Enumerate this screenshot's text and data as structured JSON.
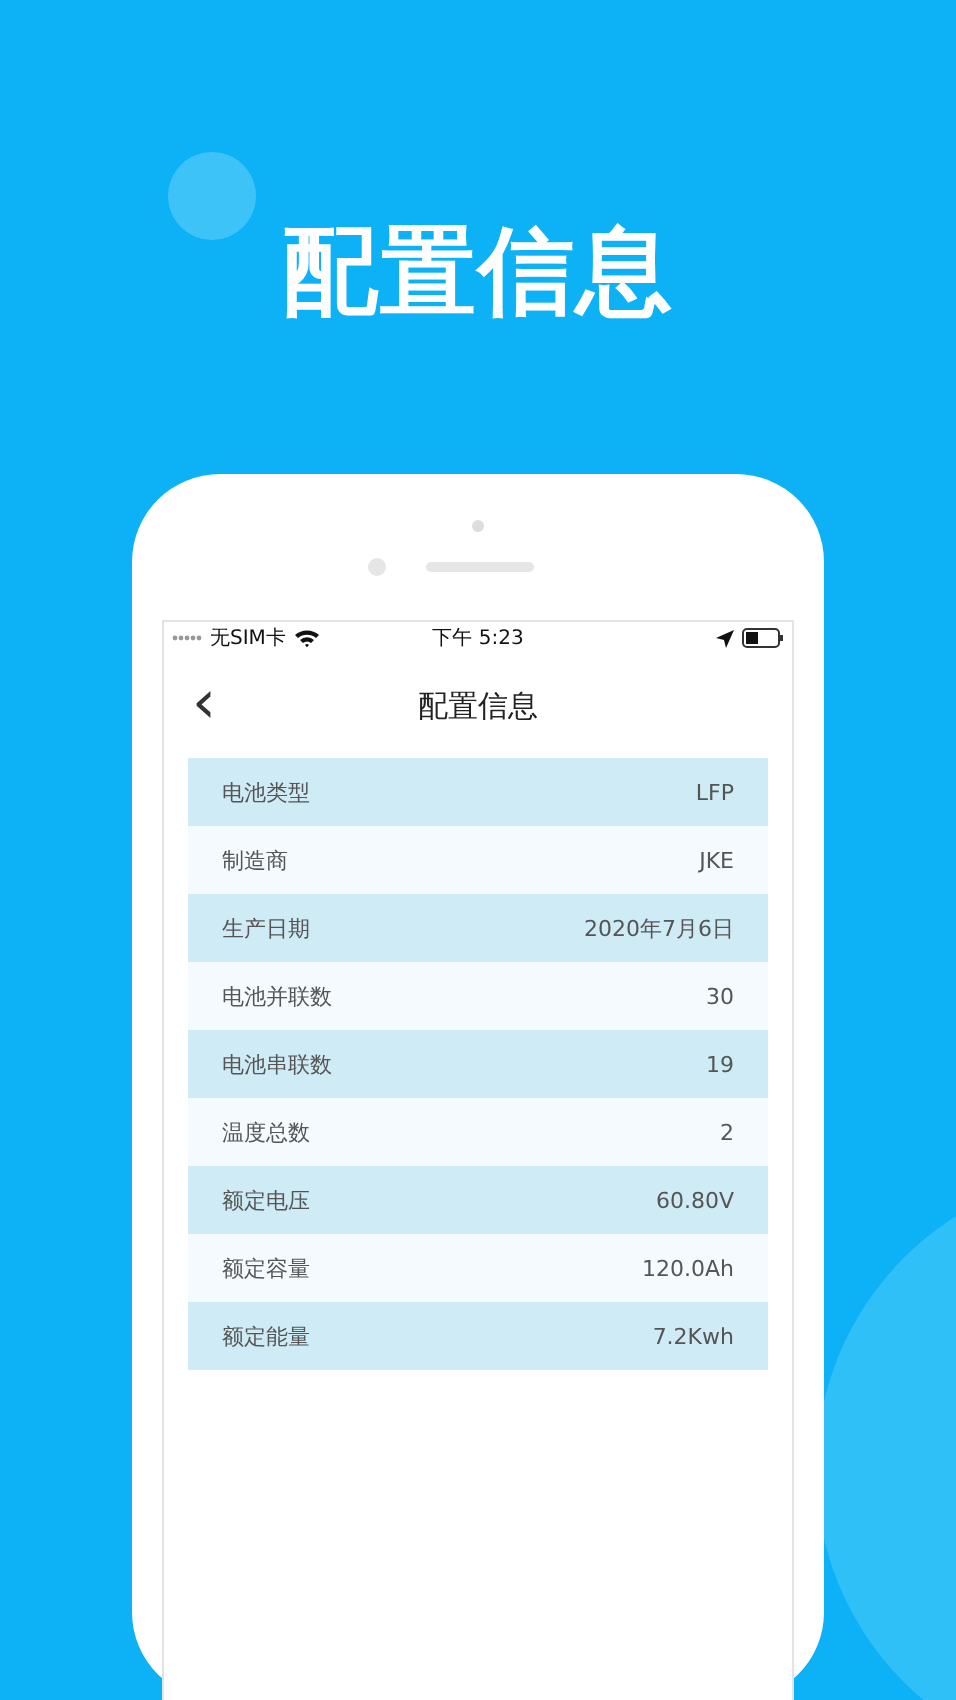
{
  "headline": "配置信息",
  "status_bar": {
    "carrier": "无SIM卡",
    "time": "下午 5:23"
  },
  "nav": {
    "back": "‹",
    "title": "配置信息"
  },
  "rows": [
    {
      "label": "电池类型",
      "value": "LFP"
    },
    {
      "label": "制造商",
      "value": "JKE"
    },
    {
      "label": "生产日期",
      "value": "2020年7月6日"
    },
    {
      "label": "电池并联数",
      "value": "30"
    },
    {
      "label": "电池串联数",
      "value": "19"
    },
    {
      "label": "温度总数",
      "value": "2"
    },
    {
      "label": "额定电压",
      "value": "60.80V"
    },
    {
      "label": "额定容量",
      "value": "120.0Ah"
    },
    {
      "label": "额定能量",
      "value": "7.2Kwh"
    }
  ]
}
